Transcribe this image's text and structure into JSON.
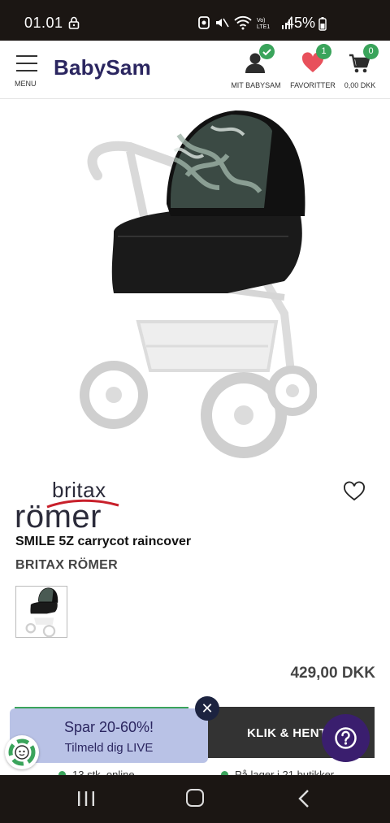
{
  "status_bar": {
    "time": "01.01",
    "battery": "45%"
  },
  "header": {
    "menu_label": "MENU",
    "logo": "BabySam",
    "account_label": "MIT BABYSAM",
    "favorites_label": "FAVORITTER",
    "favorites_count": "1",
    "cart_label": "0,00 DKK",
    "cart_count": "0"
  },
  "product": {
    "brand_logo_line1": "britax",
    "brand_logo_line2": "römer",
    "title": "SMILE 5Z carrycot raincover",
    "brand": "BRITAX RÖMER",
    "price": "429,00 DKK"
  },
  "actions": {
    "click_collect_label": "KLIK & HENT"
  },
  "promo": {
    "line1": "Spar 20-60%!",
    "line2": "Tilmeld dig LIVE",
    "close_symbol": "✕"
  },
  "stock": {
    "online": "13 stk. online",
    "stores": "På lager i 21 butikker"
  },
  "colors": {
    "brand_navy": "#2b2660",
    "accent_green": "#3aa45b",
    "heart_red": "#e8505b",
    "help_purple": "#3a1e6e"
  }
}
